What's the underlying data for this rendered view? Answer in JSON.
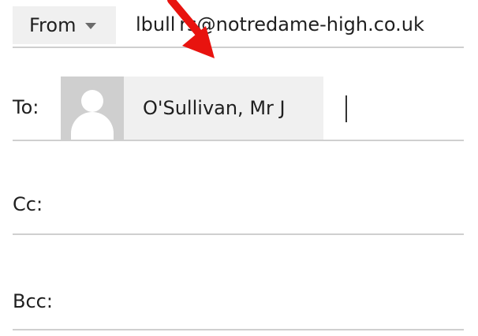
{
  "from": {
    "label": "From",
    "address": "lbull rs@notredame-high.co.uk"
  },
  "to": {
    "label": "To:",
    "recipient_name": "O'Sullivan, Mr J"
  },
  "cc": {
    "label": "Cc:"
  },
  "bcc": {
    "label": "Bcc:"
  },
  "icons": {
    "from_dropdown": "chevron-down-icon",
    "avatar": "person-placeholder-icon",
    "annotation": "red-arrow-icon"
  },
  "colors": {
    "annotation": "#e8130f",
    "chip_background": "#f0f0f0",
    "avatar_background": "#cfcfcf",
    "divider": "#cfcfcf"
  }
}
